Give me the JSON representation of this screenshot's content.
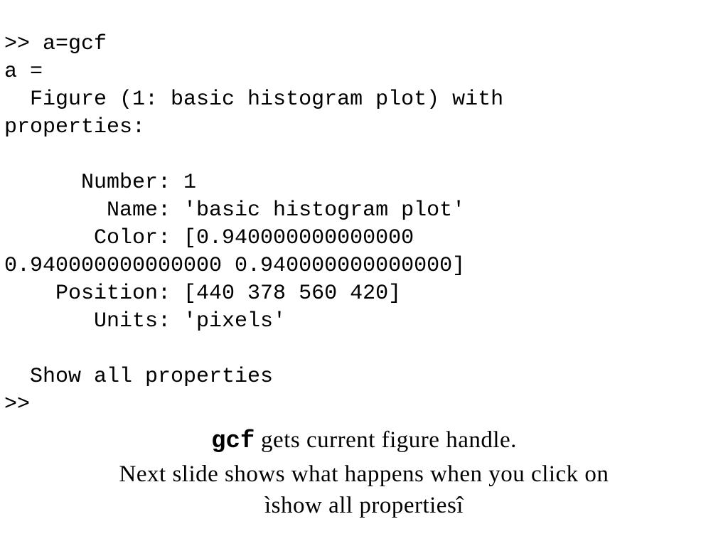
{
  "code": {
    "line1": ">> a=gcf",
    "line2": "a =",
    "line3": "  Figure (1: basic histogram plot) with",
    "line4": "properties:",
    "line5": "",
    "line6": "      Number: 1",
    "line7": "        Name: 'basic histogram plot'",
    "line8": "       Color: [0.940000000000000",
    "line9": "0.940000000000000 0.940000000000000]",
    "line10": "    Position: [440 378 560 420]",
    "line11": "       Units: 'pixels'",
    "line12": "",
    "line13": "  Show all properties",
    "line14": ">>"
  },
  "caption": {
    "kw": "gcf",
    "rest1": " gets current figure handle.",
    "line2": "Next slide shows what happens when you click on",
    "line3": "ìshow all propertiesî"
  }
}
